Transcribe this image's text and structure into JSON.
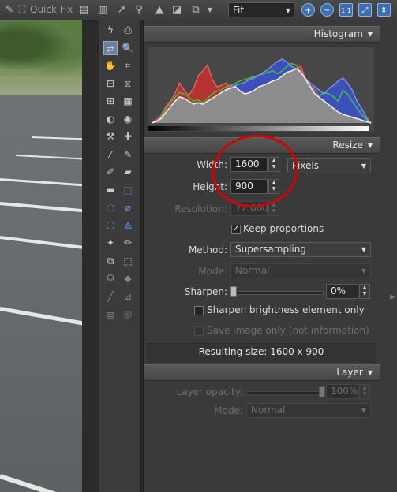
{
  "toolbar": {
    "quick_fix_label": "Quick Fix",
    "zoom": {
      "value": "Fit"
    },
    "zoom_buttons": [
      "+",
      "−",
      "1:1",
      "⤢",
      "⇕"
    ]
  },
  "histogram": {
    "title": "Histogram",
    "series": {
      "red": [
        0,
        4,
        10,
        22,
        30,
        40,
        55,
        45,
        38,
        48,
        65,
        72,
        80,
        60,
        50,
        52,
        55,
        48,
        50,
        44,
        40,
        42,
        45,
        50,
        52,
        55,
        58,
        60,
        65,
        70,
        72,
        75,
        78,
        60,
        52,
        45,
        35,
        30,
        25,
        20,
        15,
        12,
        10,
        8,
        6,
        4,
        2,
        0
      ],
      "green": [
        0,
        3,
        8,
        18,
        28,
        35,
        42,
        40,
        36,
        30,
        32,
        28,
        34,
        40,
        44,
        46,
        50,
        52,
        55,
        58,
        60,
        62,
        64,
        66,
        68,
        70,
        72,
        68,
        72,
        78,
        82,
        80,
        70,
        60,
        50,
        40,
        38,
        42,
        40,
        36,
        30,
        45,
        40,
        30,
        20,
        12,
        5,
        0
      ],
      "blue": [
        0,
        2,
        6,
        14,
        22,
        30,
        36,
        34,
        30,
        26,
        28,
        26,
        30,
        34,
        38,
        42,
        46,
        50,
        52,
        54,
        56,
        60,
        62,
        66,
        70,
        74,
        80,
        85,
        88,
        84,
        78,
        75,
        70,
        62,
        55,
        50,
        45,
        40,
        48,
        52,
        58,
        62,
        55,
        45,
        30,
        20,
        8,
        0
      ]
    },
    "colors": {
      "red": "#c8302f",
      "green": "#3fbf3a",
      "blue": "#3a52d8",
      "gray": "#8d8d8d"
    }
  },
  "resize": {
    "title": "Resize",
    "width_label": "Width:",
    "width_value": "1600",
    "units": "Pixels",
    "height_label": "Height:",
    "height_value": "900",
    "resolution_label": "Resolution:",
    "resolution_value": "72.000",
    "keep_proportions_label": "Keep proportions",
    "keep_proportions_checked": true,
    "method_label": "Method:",
    "method_value": "Supersampling",
    "mode_label": "Mode:",
    "mode_value": "Normal",
    "sharpen_label": "Sharpen:",
    "sharpen_value": "0%",
    "sharpen_brightness_label": "Sharpen brightness element only",
    "save_image_only_label": "Save image only (not information)",
    "resulting_size": "Resulting size:  1600 x 900"
  },
  "layer": {
    "title": "Layer",
    "opacity_label": "Layer opacity:",
    "opacity_value": "100%",
    "mode_label": "Mode:",
    "mode_value": "Normal"
  },
  "annotation_color": "#d40000"
}
